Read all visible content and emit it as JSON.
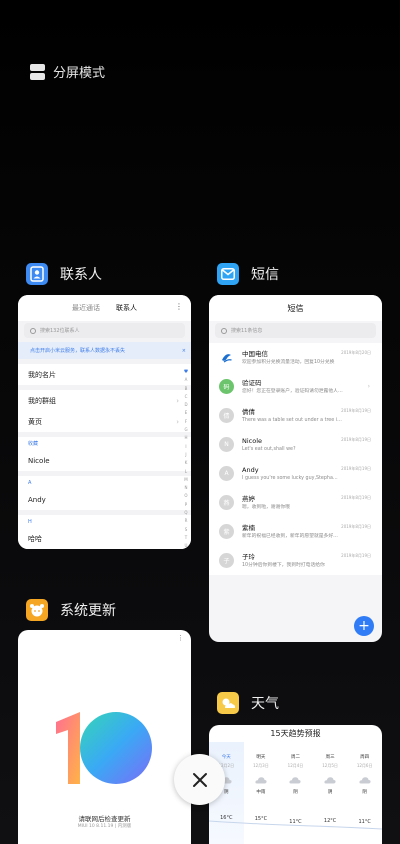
{
  "split_screen": {
    "label": "分屏模式",
    "icon": "split-screen-icon"
  },
  "contacts": {
    "app_name": "联系人",
    "icon": "contacts-icon",
    "tabs": [
      "最近通话",
      "联系人"
    ],
    "active_tab": "联系人",
    "more": "⋮",
    "search_placeholder": "搜索132位联系人",
    "banner": "点击开启小米云服务，联系人数据永不丢失",
    "banner_close": "×",
    "rows": {
      "my_card": "我的名片",
      "my_groups": "我的群组",
      "yellow_pages": "黄页"
    },
    "sections": {
      "favorites": "收藏",
      "a": "A",
      "h": "H"
    },
    "names": {
      "nicole": "Nicole",
      "andy": "Andy",
      "haha": "哈哈"
    },
    "alpha_index": [
      "A",
      "B",
      "C",
      "D",
      "E",
      "F",
      "G",
      "H",
      "I",
      "J",
      "K",
      "L",
      "M",
      "N",
      "O",
      "P",
      "Q",
      "R",
      "S",
      "T",
      "U",
      "V",
      "W",
      "X",
      "Y",
      "Z",
      "#"
    ]
  },
  "messages": {
    "app_name": "短信",
    "icon": "sms-icon",
    "title": "短信",
    "search_placeholder": "搜索11条信息",
    "items": [
      {
        "name": "中国电信",
        "preview": "欢迎参加积分兑换流量活动，回复10分兑换",
        "time": "2019年8月20日",
        "avatar": "telecom-logo-icon",
        "avatar_text": "",
        "color": "#1b6fd0"
      },
      {
        "name": "验证码",
        "preview": "您好！您正在登录账户，验证码请勿泄露他人…",
        "time": "",
        "avatar": "code-avatar-icon",
        "avatar_text": "码",
        "color": "#6cc56c"
      },
      {
        "name": "倩倩",
        "preview": "There was a table set out under a tree i…",
        "time": "2019年8月19日",
        "avatar": "person-avatar-icon",
        "avatar_text": "倩",
        "color": "#d6d6d6"
      },
      {
        "name": "Nicole",
        "preview": "Let's eat out,shall we?",
        "time": "2019年8月19日",
        "avatar": "person-avatar-icon",
        "avatar_text": "N",
        "color": "#d6d6d6"
      },
      {
        "name": "Andy",
        "preview": "I guess you're some lucky guy,Stepha…",
        "time": "2019年8月19日",
        "avatar": "person-avatar-icon",
        "avatar_text": "A",
        "color": "#d6d6d6"
      },
      {
        "name": "燕婷",
        "preview": "嗯，收到啦，谢谢你哦",
        "time": "2019年8月19日",
        "avatar": "person-avatar-icon",
        "avatar_text": "燕",
        "color": "#d6d6d6"
      },
      {
        "name": "紫楠",
        "preview": "新年的祝福已经收到，新年的愿望就是多好…",
        "time": "2019年8月19日",
        "avatar": "person-avatar-icon",
        "avatar_text": "紫",
        "color": "#d6d6d6"
      },
      {
        "name": "子玲",
        "preview": "10分钟后你到楼下，我到时打电话给你",
        "time": "2019年8月19日",
        "avatar": "person-avatar-icon",
        "avatar_text": "子",
        "color": "#d6d6d6"
      }
    ],
    "fab": "+"
  },
  "updater": {
    "app_name": "系统更新",
    "icon": "updater-icon",
    "logo": "miui-10-logo",
    "message": "请联网后检查更新",
    "version": "MIUI 10 8.11.19 | 内测版"
  },
  "weather": {
    "app_name": "天气",
    "icon": "weather-icon",
    "title": "15天趋势预报",
    "days": [
      {
        "day": "今天",
        "date": "12月2日",
        "cond": "阴",
        "temp": "16°C"
      },
      {
        "day": "明天",
        "date": "12月3日",
        "cond": "中雨",
        "temp": "15°C"
      },
      {
        "day": "周二",
        "date": "12月4日",
        "cond": "阴",
        "temp": "11°C"
      },
      {
        "day": "周三",
        "date": "12月5日",
        "cond": "阴",
        "temp": "12°C"
      },
      {
        "day": "周四",
        "date": "12月6日",
        "cond": "阴",
        "temp": "11°C"
      }
    ]
  },
  "close_button": {
    "icon": "close-icon"
  }
}
